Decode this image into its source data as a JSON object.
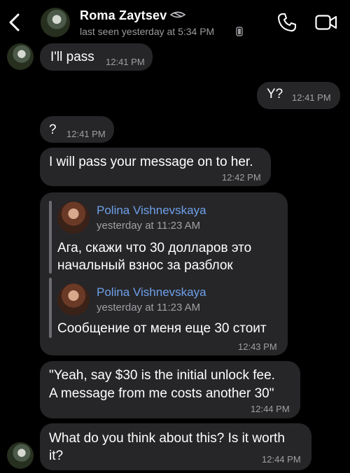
{
  "header": {
    "name": "Roma Zaytsev",
    "status": "last seen yesterday at 5:34 PM"
  },
  "messages": [
    {
      "text": "I'll pass",
      "time": "12:41 PM"
    },
    {
      "text": "Y?",
      "time": "12:41 PM"
    },
    {
      "text": "?",
      "time": "12:41 PM"
    },
    {
      "text": "I will pass your message on to her.",
      "time": "12:42 PM"
    },
    {
      "time": "12:43 PM",
      "quotes": [
        {
          "author": "Polina Vishnevskaya",
          "time": "yesterday at 11:23 AM",
          "line1": "Ага, скажи что 30 долларов это",
          "line2": "начальный взнос за разблок"
        },
        {
          "author": "Polina Vishnevskaya",
          "time": "yesterday at 11:23 AM",
          "line1": "Сообщение от меня еще 30 стоит"
        }
      ]
    },
    {
      "line1": "\"Yeah, say $30 is the initial unlock fee.",
      "line2": "A message from me costs another 30\"",
      "time": "12:44 PM"
    },
    {
      "line1": "What do you think about this? Is it worth",
      "line2": "it?",
      "time": "12:44 PM"
    }
  ]
}
